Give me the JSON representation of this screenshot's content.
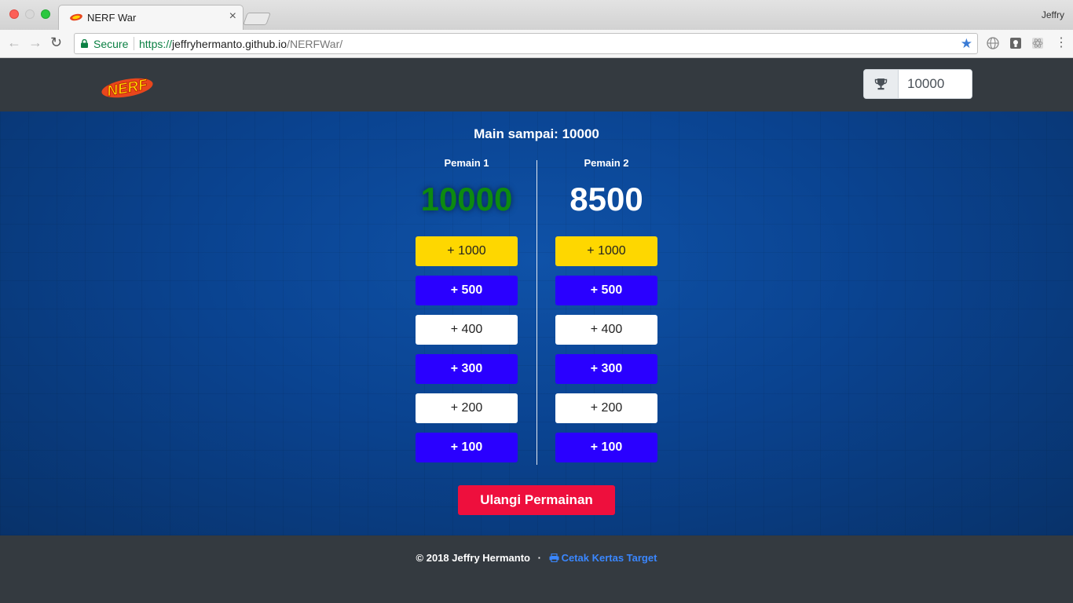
{
  "browser": {
    "tab_title": "NERF War",
    "profile_name": "Jeffry",
    "secure_label": "Secure",
    "url_scheme": "https://",
    "url_host": "jeffryhermanto.github.io",
    "url_path": "/NERFWar/"
  },
  "navbar": {
    "logo_icon": "nerf-logo",
    "trophy_icon": "trophy-icon",
    "target_value": "10000"
  },
  "game": {
    "goal_label": "Main sampai:",
    "goal_value": "10000",
    "players": [
      {
        "name": "Pemain 1",
        "score": "10000",
        "buttons": [
          "+ 1000",
          "+ 500",
          "+ 400",
          "+ 300",
          "+ 200",
          "+ 100"
        ]
      },
      {
        "name": "Pemain 2",
        "score": "8500",
        "buttons": [
          "+ 1000",
          "+ 500",
          "+ 400",
          "+ 300",
          "+ 200",
          "+ 100"
        ]
      }
    ],
    "reset_label": "Ulangi Permainan"
  },
  "colors": {
    "yellow_button": "#fed700",
    "blue_button": "#2a00ff",
    "reset_button": "#ee0f3d",
    "winner_score": "#0d8a10",
    "link": "#3a87ff"
  },
  "footer": {
    "copyright": "© 2018 Jeffry Hermanto",
    "separator": "·",
    "print_label": "Cetak Kertas Target",
    "print_icon": "printer-icon"
  }
}
